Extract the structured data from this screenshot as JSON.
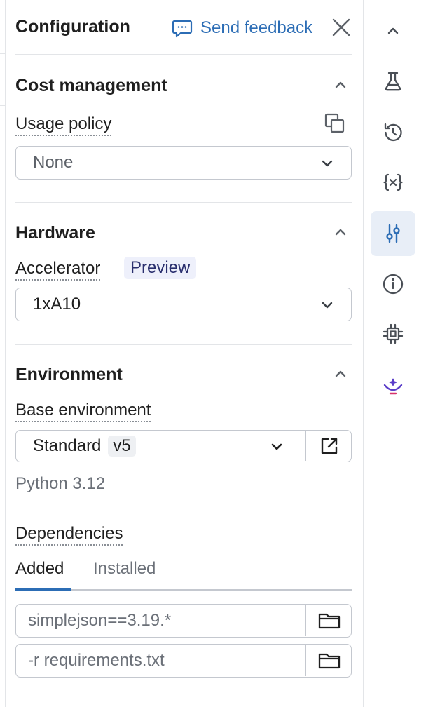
{
  "header": {
    "title": "Configuration",
    "feedback_label": "Send feedback"
  },
  "cost_management": {
    "title": "Cost management",
    "usage_policy_label": "Usage policy",
    "usage_policy_value": "None"
  },
  "hardware": {
    "title": "Hardware",
    "accelerator_label": "Accelerator",
    "preview_badge": "Preview",
    "accelerator_value": "1xA10"
  },
  "environment": {
    "title": "Environment",
    "base_env_label": "Base environment",
    "base_env_value": "Standard",
    "base_env_version": "v5",
    "python_version": "Python 3.12",
    "dependencies_label": "Dependencies",
    "tabs": [
      {
        "label": "Added",
        "active": true
      },
      {
        "label": "Installed",
        "active": false
      }
    ],
    "dependencies": [
      {
        "value": "simplejson==3.19.*"
      },
      {
        "value": "-r requirements.txt"
      }
    ]
  },
  "rail": {
    "items": [
      {
        "icon": "chevron-up-icon"
      },
      {
        "icon": "flask-icon"
      },
      {
        "icon": "history-icon"
      },
      {
        "icon": "variables-icon"
      },
      {
        "icon": "sliders-icon",
        "active": true
      },
      {
        "icon": "info-icon"
      },
      {
        "icon": "chip-icon"
      },
      {
        "icon": "assistant-icon"
      }
    ]
  },
  "colors": {
    "accent": "#2c6db5",
    "active_rail_bg": "#e8eef7",
    "border": "#c4c8cf",
    "muted_text": "#6b7078",
    "badge_bg": "#eef0fb"
  }
}
